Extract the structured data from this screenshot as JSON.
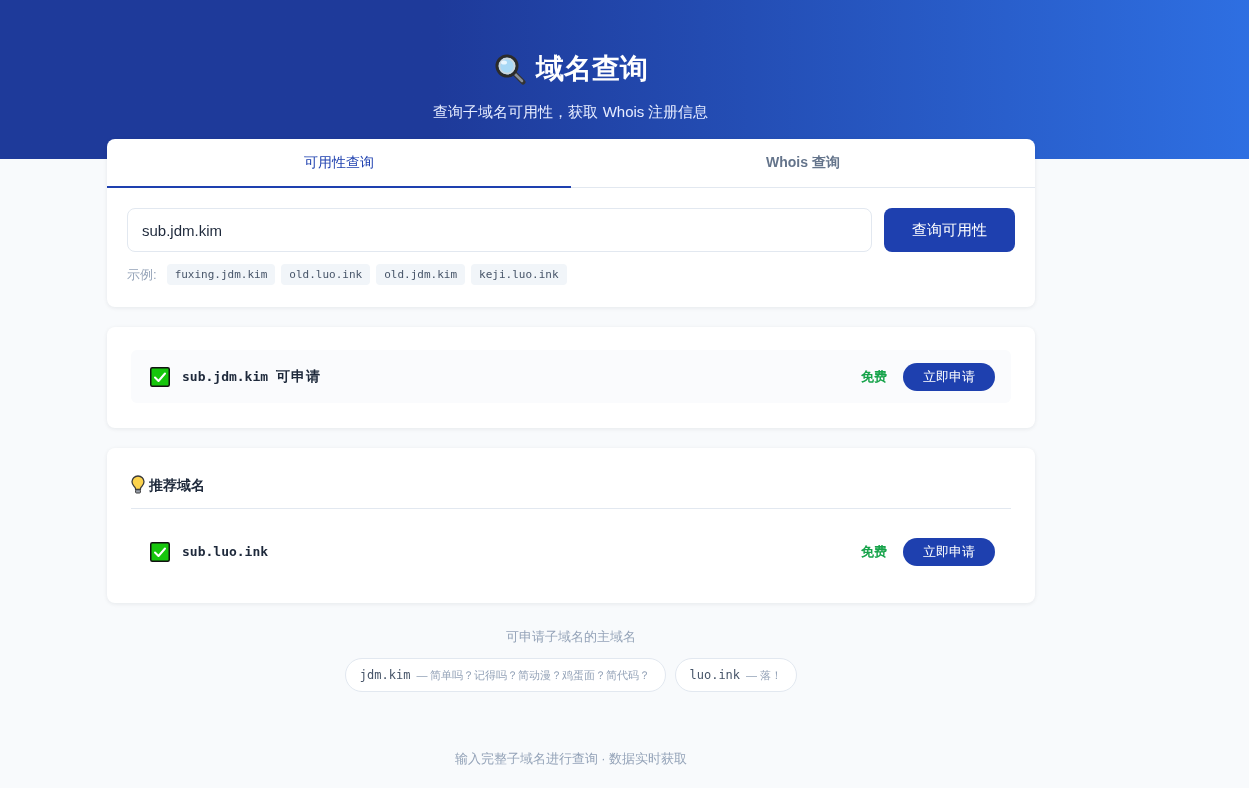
{
  "header": {
    "title": "域名查询",
    "subtitle": "查询子域名可用性，获取 Whois 注册信息"
  },
  "tabs": [
    {
      "label": "可用性查询",
      "selected": true
    },
    {
      "label": "Whois 查询",
      "selected": false
    }
  ],
  "search": {
    "value": "sub.jdm.kim",
    "button": "查询可用性",
    "examples_label": "示例:",
    "examples": [
      "fuxing.jdm.kim",
      "old.luo.ink",
      "old.jdm.kim",
      "keji.luo.ink"
    ]
  },
  "result": {
    "available": true,
    "domain": "sub.jdm.kim",
    "status": "可申请",
    "price": "免费",
    "action": "立即申请"
  },
  "recommendations": {
    "title": "推荐域名",
    "items": [
      {
        "available": true,
        "domain": "sub.luo.ink",
        "price": "免费",
        "action": "立即申请"
      }
    ]
  },
  "main_domains": {
    "title": "可申请子域名的主域名",
    "items": [
      {
        "domain": "jdm.kim",
        "note": "— 简单吗？记得吗？简动漫？鸡蛋面？简代码？"
      },
      {
        "domain": "luo.ink",
        "note": "— 落！"
      }
    ]
  },
  "footer": "输入完整子域名进行查询 · 数据实时获取"
}
